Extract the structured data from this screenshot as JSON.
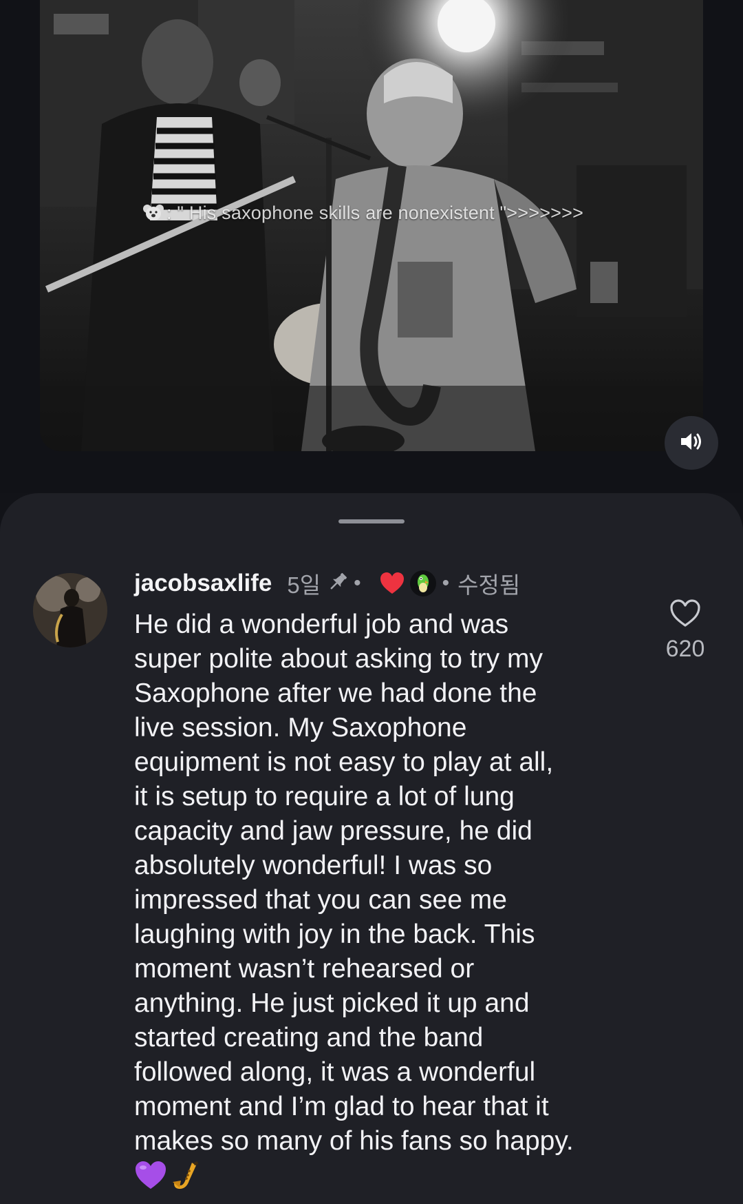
{
  "video": {
    "caption": ": \" His saxophone skills are nonexistent \">>>>>>>",
    "mute_icon": "volume-on-icon"
  },
  "comment": {
    "username": "jacobsaxlife",
    "time": "5일",
    "separator": "•",
    "edited_label": "수정됨",
    "text": "He did a wonderful job and was\nsuper polite about asking to try my\nSaxophone after we had done the\nlive session. My Saxophone\nequipment is not easy to play at all,\nit is setup to require a lot of lung\ncapacity and jaw pressure, he did\nabsolutely wonderful! I was so\nimpressed that you can see me\nlaughing with joy in the back. This\nmoment wasn’t rehearsed or\nanything. He just picked it up and\nstarted creating and the band\nfollowed along, it was a wonderful\nmoment and I’m glad to hear that it\nmakes so many of his fans so happy.",
    "like_count": "620",
    "icons": {
      "pin": "pin-icon",
      "creator_heart": "heart-icon",
      "creator_avatar": "creator-avatar",
      "like": "heart-outline-icon",
      "emojis": [
        "purple-heart-emoji",
        "saxophone-emoji"
      ]
    }
  },
  "colors": {
    "sheet_bg": "#1f2026",
    "page_bg": "#121318",
    "creator_heart": "#ee3340",
    "muted_text": "#a2a4ab"
  }
}
